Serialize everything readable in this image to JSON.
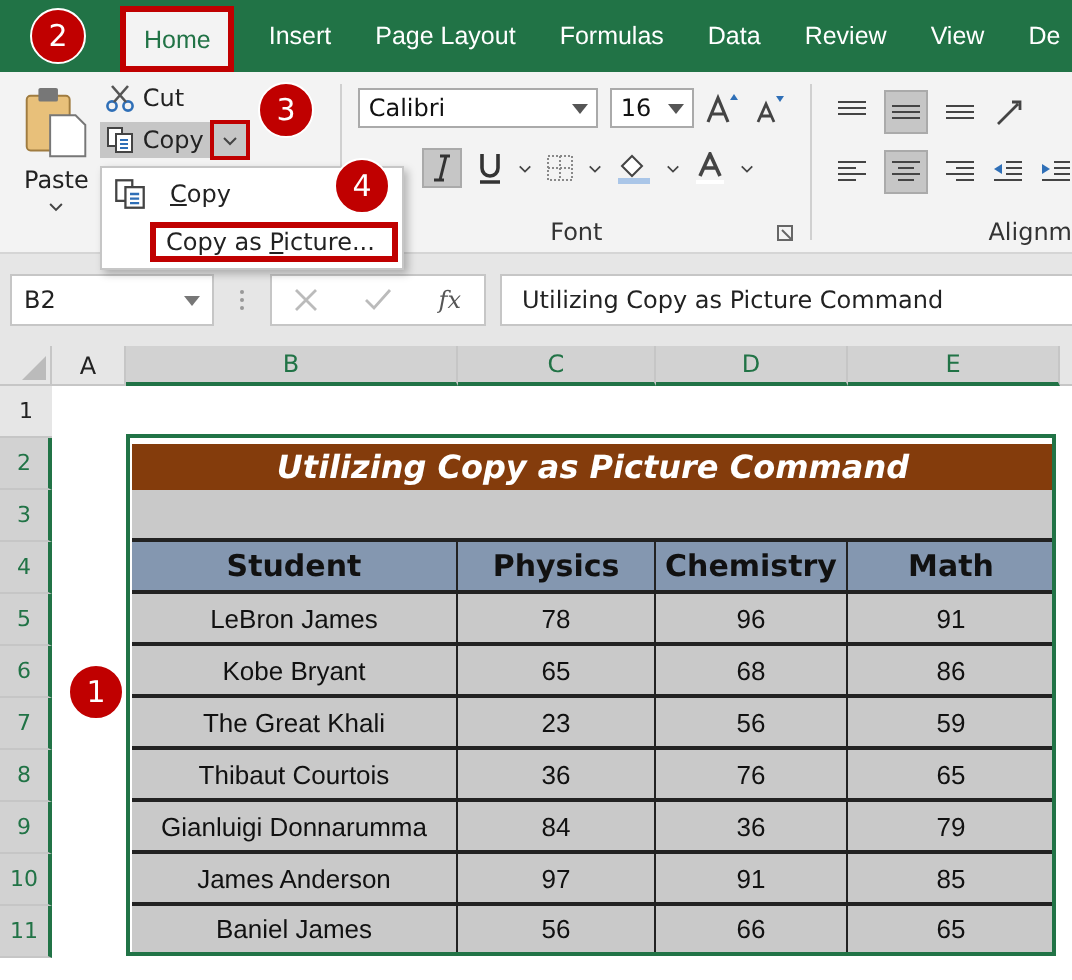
{
  "ribbon": {
    "tabs": [
      {
        "label": "Home",
        "selected": true
      },
      {
        "label": "Insert",
        "selected": false
      },
      {
        "label": "Page Layout",
        "selected": false
      },
      {
        "label": "Formulas",
        "selected": false
      },
      {
        "label": "Data",
        "selected": false
      },
      {
        "label": "Review",
        "selected": false
      },
      {
        "label": "View",
        "selected": false
      },
      {
        "label": "De",
        "selected": false
      }
    ],
    "clipboard": {
      "paste": "Paste",
      "cut": "Cut",
      "copy": "Copy"
    },
    "font": {
      "name": "Calibri",
      "size": "16",
      "group_label": "Font"
    },
    "alignment": {
      "group_label": "Alignm"
    }
  },
  "copy_menu": {
    "items": [
      {
        "key": "C",
        "after": "opy",
        "highlighted": false
      },
      {
        "before": "Copy as ",
        "key": "P",
        "after": "icture...",
        "highlighted": true
      }
    ]
  },
  "formula_bar": {
    "name_box": "B2",
    "fx": "fx",
    "formula": "Utilizing Copy as Picture Command"
  },
  "sheet": {
    "column_headers": [
      "A",
      "B",
      "C",
      "D",
      "E"
    ],
    "row_numbers": [
      "1",
      "2",
      "3",
      "4",
      "5",
      "6",
      "7",
      "8",
      "9",
      "10",
      "11"
    ],
    "title": "Utilizing Copy as Picture Command",
    "columns": [
      "Student",
      "Physics",
      "Chemistry",
      "Math"
    ],
    "rows": [
      [
        "LeBron James",
        "78",
        "96",
        "91"
      ],
      [
        "Kobe Bryant",
        "65",
        "68",
        "86"
      ],
      [
        "The Great Khali",
        "23",
        "56",
        "59"
      ],
      [
        "Thibaut Courtois",
        "36",
        "76",
        "65"
      ],
      [
        "Gianluigi Donnarumma",
        "84",
        "36",
        "79"
      ],
      [
        "James Anderson",
        "97",
        "91",
        "85"
      ],
      [
        "Baniel James",
        "56",
        "66",
        "65"
      ]
    ]
  },
  "callouts": [
    {
      "label": "1",
      "kind": "range"
    },
    {
      "label": "2",
      "kind": "tab"
    },
    {
      "label": "3",
      "kind": "dropdown"
    },
    {
      "label": "4",
      "kind": "menu"
    }
  ]
}
